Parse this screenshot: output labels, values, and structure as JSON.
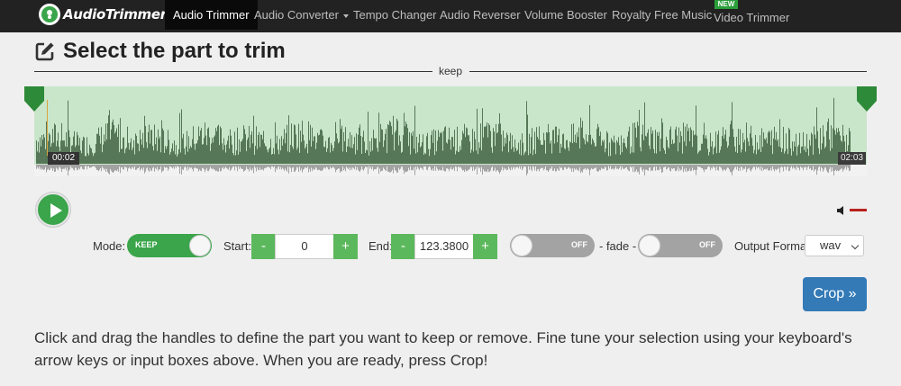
{
  "nav": {
    "logo_text": "AudioTrimmer",
    "items": [
      {
        "label": "Audio Trimmer",
        "active": true
      },
      {
        "label": "Audio Converter",
        "has_dropdown": true
      },
      {
        "label": "Tempo Changer"
      },
      {
        "label": "Audio Reverser"
      },
      {
        "label": "Volume Booster"
      },
      {
        "label": "Royalty Free Music"
      },
      {
        "label": "Video Trimmer",
        "badge": "NEW"
      }
    ]
  },
  "title": "Select the part to trim",
  "mode_divider_label": "keep",
  "waveform": {
    "start_time": "00:02",
    "end_time": "02:03",
    "selection_start_fraction": 0.0,
    "selection_end_fraction": 1.0
  },
  "player": {
    "play_icon": "play-icon",
    "speaker_icon": "speaker-icon",
    "volume_fraction": 1.0
  },
  "controls": {
    "mode_label": "Mode:",
    "mode_value": "KEEP",
    "start_label": "Start:",
    "start_value": "0",
    "end_label": "End:",
    "end_value": "123.3800",
    "minus": "-",
    "plus": "+",
    "fade_in_value": "OFF",
    "fade_label": "- fade -",
    "fade_out_value": "OFF",
    "output_format_label": "Output Format",
    "output_format_value": "wav"
  },
  "crop_button": "Crop »",
  "instructions": "Click and drag the handles to define the part you want to keep or remove. Fine tune your selection using your keyboard's arrow keys or input boxes above. When you are ready, press Crop!",
  "colors": {
    "nav_bg": "#222222",
    "accent_green": "#3aa54a",
    "selection_fill": "#c9e6cb",
    "crop_blue": "#337ab7"
  }
}
